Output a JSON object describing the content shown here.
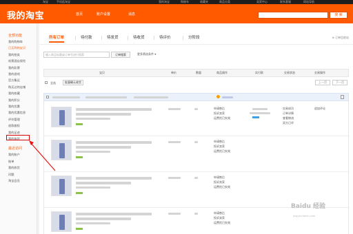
{
  "topbar": {
    "left_user": "淘宝",
    "left_links": "手机逛淘宝",
    "right_links": [
      "我的淘宝",
      "购物车",
      "收藏夹",
      "商品分类",
      "卖家中心",
      "联系客服",
      "网站导航"
    ]
  },
  "header": {
    "logo": "我的淘宝",
    "nav": [
      "首页",
      "账户设置",
      "消息"
    ],
    "search_button": "搜 索"
  },
  "sidebar": {
    "groups": [
      {
        "label": "全部功能",
        "type": "head"
      },
      {
        "label": "我的购物车",
        "type": "item"
      },
      {
        "label": "已买到的宝贝",
        "type": "sub"
      },
      {
        "label": "我的拍卖",
        "type": "item"
      },
      {
        "label": "机票酒店保险",
        "type": "item"
      },
      {
        "label": "我的彩票",
        "type": "item"
      },
      {
        "label": "我的游戏",
        "type": "item"
      },
      {
        "label": "官方集运",
        "type": "item"
      },
      {
        "label": "购买过的店铺",
        "type": "item"
      },
      {
        "label": "我的收藏",
        "type": "item"
      },
      {
        "label": "我的积分",
        "type": "item"
      },
      {
        "label": "我的优惠",
        "type": "item"
      },
      {
        "label": "我的优惠信息",
        "type": "item"
      },
      {
        "label": "评价管理",
        "type": "item"
      },
      {
        "label": "退款维权",
        "type": "item"
      },
      {
        "label": "我的足迹",
        "type": "item"
      },
      {
        "label": "我的体验",
        "type": "item"
      },
      {
        "label": "最近访问",
        "type": "head"
      },
      {
        "label": "我的账户",
        "type": "item"
      },
      {
        "label": "账单",
        "type": "item"
      },
      {
        "label": "我的收货",
        "type": "item"
      },
      {
        "label": "问题",
        "type": "item"
      },
      {
        "label": "淘宝会员",
        "type": "item"
      }
    ]
  },
  "tabs": [
    {
      "label": "所有订单",
      "active": true
    },
    {
      "label": "待付款",
      "active": false
    },
    {
      "label": "待发货",
      "active": false
    },
    {
      "label": "待收货",
      "active": false
    },
    {
      "label": "待评价",
      "active": false
    },
    {
      "label": "分阶段",
      "active": false
    }
  ],
  "recycle_label": "订单回收站",
  "order_search": {
    "placeholder": "输入商品标题或订单号进行搜索",
    "button": "订单搜索",
    "more": "更多筛选条件"
  },
  "table_headers": [
    "宝贝",
    "单价",
    "数量",
    "商品操作",
    "实付款",
    "交易状态",
    "交易操作"
  ],
  "select_row": {
    "select_all": "全选",
    "batch_confirm": "批量确认收货",
    "prev": "上一页",
    "next": "下一页"
  },
  "order_items": [
    {
      "actions": [
        "申请售后",
        "投诉卖家",
        "运费险已失效"
      ],
      "status": [
        "交易成功",
        "订单详情",
        "查看物流",
        "双方已评"
      ],
      "op": "追加评论"
    },
    {
      "actions": [
        "申请售后",
        "投诉卖家",
        "运费险已失效"
      ]
    },
    {
      "actions": [
        "申请售后",
        "投诉卖家",
        "运费险已失效"
      ]
    },
    {
      "actions": [
        "申请售后",
        "投诉卖家",
        "运费险已失效"
      ]
    }
  ],
  "watermark": {
    "main": "Baidu 经验",
    "sub": "jingyan.baidu.com"
  },
  "colors": {
    "brand": "#ff5a00",
    "highlight": "#dd0000"
  }
}
